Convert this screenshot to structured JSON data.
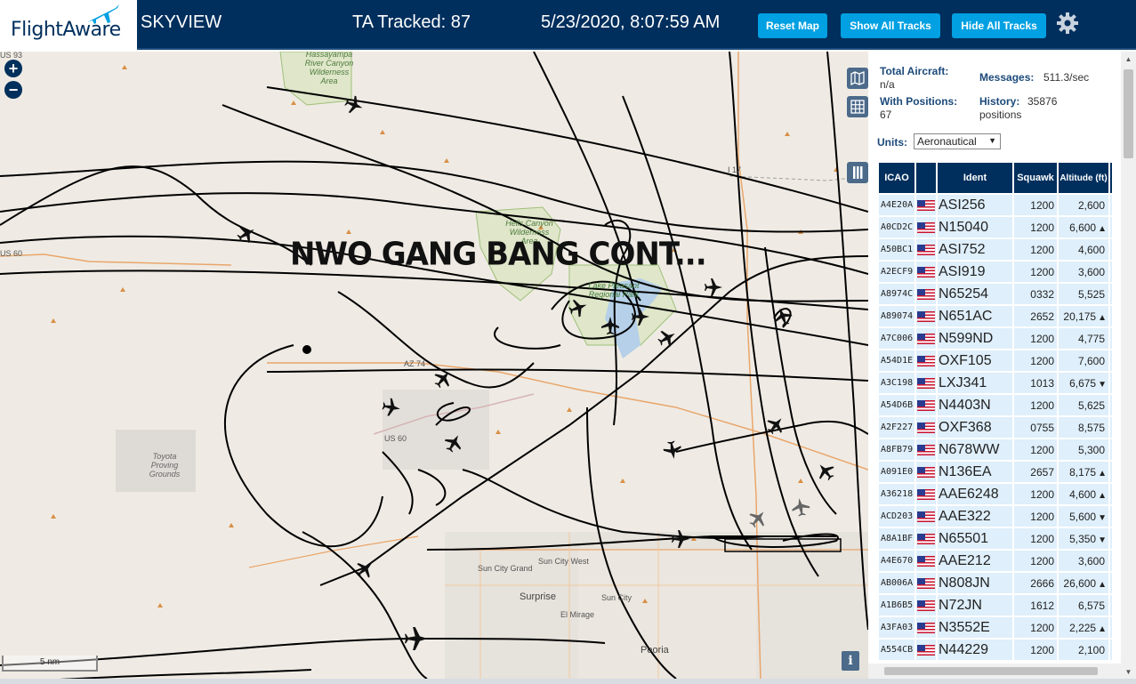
{
  "header": {
    "logo_text": "FlightAware",
    "app_title": "SKYVIEW",
    "tracked_label": "TA Tracked: 87",
    "datetime": "5/23/2020, 8:07:59 AM",
    "reset_label": "Reset Map",
    "show_all_label": "Show All Tracks",
    "hide_all_label": "Hide All Tracks",
    "settings_icon": "gear-icon"
  },
  "map": {
    "overlay_text": "NWO GANG BANG CONT...",
    "zoom_in": "+",
    "zoom_out": "−",
    "scale_label": "5 nm",
    "info_label": "i",
    "labels": {
      "hassayampa": "Hassayampa River Canyon Wilderness Area",
      "hells_canyon": "Hells Canyon Wilderness Area",
      "lake_pleasant": "Lake Pleasant Regional Park",
      "toyota": "Toyota Proving Grounds",
      "sun_city_grand": "Sun City Grand",
      "sun_city_west": "Sun City West",
      "surprise": "Surprise",
      "el_mirage": "El Mirage",
      "sun_city": "Sun City",
      "peoria": "Peoria",
      "az74": "AZ 74",
      "us60a": "US 60",
      "us60b": "US 60",
      "i17": "I 17",
      "us93": "US 93"
    },
    "colors": {
      "land": "#efebe4",
      "park": "#cfe0b3",
      "water": "#b5d0e8",
      "track": "#000000"
    }
  },
  "sidebar": {
    "total_aircraft_label": "Total Aircraft:",
    "total_aircraft_value": "n/a",
    "messages_label": "Messages:",
    "messages_value": "511.3/sec",
    "with_positions_label": "With Positions:",
    "with_positions_value": "67",
    "history_label": "History:",
    "history_value": "35876",
    "history_unit": "positions",
    "units_label": "Units:",
    "units_value": "Aeronautical"
  },
  "table": {
    "headers": {
      "icao": "ICAO",
      "ident": "Ident",
      "squawk": "Squawk",
      "altitude": "Altitude (ft)"
    },
    "rows": [
      {
        "icao": "A4E20A",
        "ident": "ASI256",
        "squawk": "1200",
        "altitude": "2,600",
        "trend": ""
      },
      {
        "icao": "A0CD2C",
        "ident": "N15040",
        "squawk": "1200",
        "altitude": "6,600",
        "trend": "▲"
      },
      {
        "icao": "A50BC1",
        "ident": "ASI752",
        "squawk": "1200",
        "altitude": "4,600",
        "trend": ""
      },
      {
        "icao": "A2ECF9",
        "ident": "ASI919",
        "squawk": "1200",
        "altitude": "3,600",
        "trend": ""
      },
      {
        "icao": "A8974C",
        "ident": "N65254",
        "squawk": "0332",
        "altitude": "5,525",
        "trend": ""
      },
      {
        "icao": "A89074",
        "ident": "N651AC",
        "squawk": "2652",
        "altitude": "20,175",
        "trend": "▲"
      },
      {
        "icao": "A7C006",
        "ident": "N599ND",
        "squawk": "1200",
        "altitude": "4,775",
        "trend": ""
      },
      {
        "icao": "A54D1E",
        "ident": "OXF105",
        "squawk": "1200",
        "altitude": "7,600",
        "trend": ""
      },
      {
        "icao": "A3C198",
        "ident": "LXJ341",
        "squawk": "1013",
        "altitude": "6,675",
        "trend": "▼"
      },
      {
        "icao": "A54D6B",
        "ident": "N4403N",
        "squawk": "1200",
        "altitude": "5,625",
        "trend": ""
      },
      {
        "icao": "A2F227",
        "ident": "OXF368",
        "squawk": "0755",
        "altitude": "8,575",
        "trend": ""
      },
      {
        "icao": "A8FB79",
        "ident": "N678WW",
        "squawk": "1200",
        "altitude": "5,300",
        "trend": ""
      },
      {
        "icao": "A091E0",
        "ident": "N136EA",
        "squawk": "2657",
        "altitude": "8,175",
        "trend": "▲"
      },
      {
        "icao": "A36218",
        "ident": "AAE6248",
        "squawk": "1200",
        "altitude": "4,600",
        "trend": "▲"
      },
      {
        "icao": "ACD203",
        "ident": "AAE322",
        "squawk": "1200",
        "altitude": "5,600",
        "trend": "▼"
      },
      {
        "icao": "A8A1BF",
        "ident": "N65501",
        "squawk": "1200",
        "altitude": "5,350",
        "trend": "▼"
      },
      {
        "icao": "A4E670",
        "ident": "AAE212",
        "squawk": "1200",
        "altitude": "3,600",
        "trend": ""
      },
      {
        "icao": "AB006A",
        "ident": "N808JN",
        "squawk": "2666",
        "altitude": "26,600",
        "trend": "▲"
      },
      {
        "icao": "A1B6B5",
        "ident": "N72JN",
        "squawk": "1612",
        "altitude": "6,575",
        "trend": ""
      },
      {
        "icao": "A3FA03",
        "ident": "N3552E",
        "squawk": "1200",
        "altitude": "2,225",
        "trend": "▲"
      },
      {
        "icao": "A554CB",
        "ident": "N44229",
        "squawk": "1200",
        "altitude": "2,100",
        "trend": ""
      }
    ]
  }
}
